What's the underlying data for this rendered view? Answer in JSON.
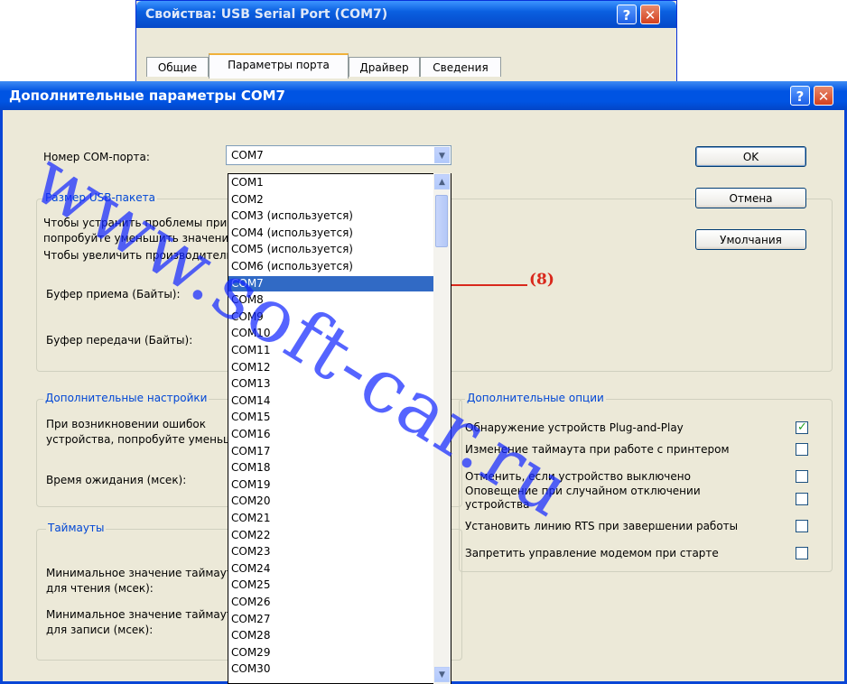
{
  "background_window": {
    "title": "Свойства: USB Serial Port (COM7)",
    "tabs": [
      "Общие",
      "Параметры порта",
      "Драйвер",
      "Сведения"
    ],
    "active_tab": 1
  },
  "dialog": {
    "title": "Дополнительные параметры COM7",
    "help_glyph": "?",
    "close_glyph": "✕",
    "com_label": "Номер COM-порта:",
    "com_selected": "COM7",
    "buttons": {
      "ok": "OK",
      "cancel": "Отмена",
      "defaults": "Умолчания"
    },
    "usb_group": {
      "label": "Размер USB-пакета",
      "line1": "Чтобы устранить проблемы при низких скоростях передачи,",
      "line2": "попробуйте уменьшить значение.",
      "line3": "Чтобы увеличить производительность, увеличьте значение.",
      "rx_label": "Буфер приема (Байты):",
      "tx_label": "Буфер передачи (Байты):"
    },
    "extra_group": {
      "label": "Дополнительные настройки",
      "line1": "При возникновении ошибок",
      "line2": "устройства, попробуйте уменьшить",
      "latency_label": "Время ожидания (мсек):"
    },
    "timeouts_group": {
      "label": "Таймауты",
      "read_line1": "Минимальное значение таймаута",
      "read_line2": "для чтения (мсек):",
      "write_line1": "Минимальное значение таймаута",
      "write_line2": "для записи (мсек):"
    },
    "options_group": {
      "label": "Дополнительные опции",
      "items": [
        {
          "label": "Обнаружение устройств Plug-and-Play",
          "checked": true
        },
        {
          "label": "Изменение таймаута при работе с принтером",
          "checked": false
        },
        {
          "label": "Отменить, если устройство выключено",
          "checked": false
        },
        {
          "label": "Оповещение при случайном отключении устройства",
          "checked": false
        },
        {
          "label": "Установить линию RTS при завершении работы",
          "checked": false
        },
        {
          "label": "Запретить управление модемом при старте",
          "checked": false
        }
      ]
    }
  },
  "dropdown": {
    "items": [
      "COM1",
      "COM2",
      "COM3 (используется)",
      "COM4 (используется)",
      "COM5 (используется)",
      "COM6 (используется)",
      "COM7",
      "COM8",
      "COM9",
      "COM10",
      "COM11",
      "COM12",
      "COM13",
      "COM14",
      "COM15",
      "COM16",
      "COM17",
      "COM18",
      "COM19",
      "COM20",
      "COM21",
      "COM22",
      "COM23",
      "COM24",
      "COM25",
      "COM26",
      "COM27",
      "COM28",
      "COM29",
      "COM30"
    ],
    "selected_index": 6
  },
  "annotation": {
    "text": "(8)",
    "color": "#d9281c"
  },
  "watermark": {
    "text": "www.soft-car.ru"
  }
}
